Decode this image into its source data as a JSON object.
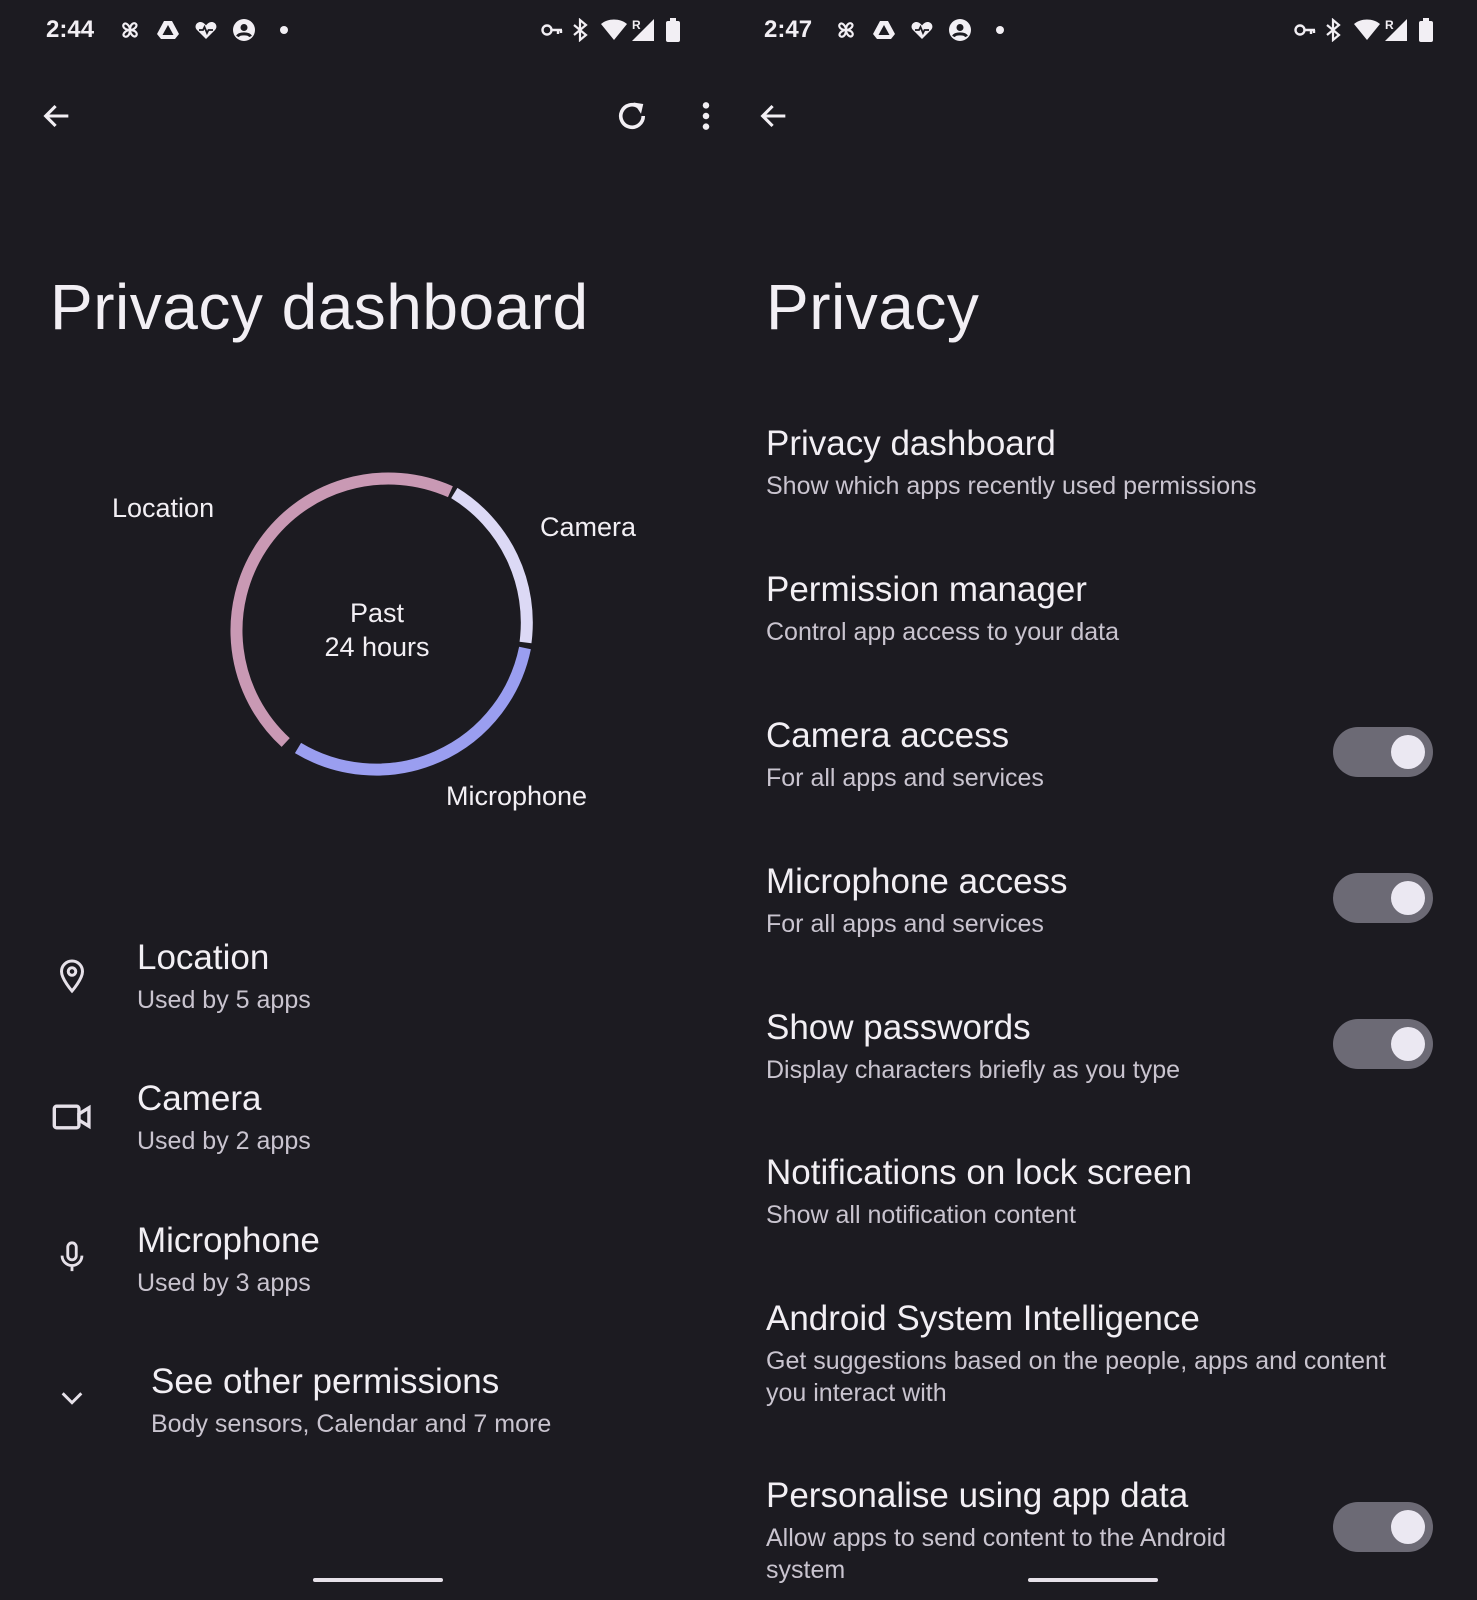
{
  "left": {
    "status_time": "2:44",
    "title": "Privacy dashboard",
    "chart": {
      "center_line1": "Past",
      "center_line2": "24 hours",
      "labels": {
        "location": "Location",
        "camera": "Camera",
        "microphone": "Microphone"
      },
      "colors": {
        "location": "#c999b4",
        "camera": "#dcd9f5",
        "microphone": "#9a9ef0"
      }
    },
    "permissions": [
      {
        "icon": "location-pin-icon",
        "title": "Location",
        "subtitle": "Used by 5 apps"
      },
      {
        "icon": "camera-icon",
        "title": "Camera",
        "subtitle": "Used by 2 apps"
      },
      {
        "icon": "microphone-icon",
        "title": "Microphone",
        "subtitle": "Used by 3 apps"
      }
    ],
    "other": {
      "icon": "chevron-down-icon",
      "title": "See other permissions",
      "subtitle": "Body sensors, Calendar and 7 more"
    }
  },
  "right": {
    "status_time": "2:47",
    "title": "Privacy",
    "settings": [
      {
        "title": "Privacy dashboard",
        "subtitle": "Show which apps recently used permissions"
      },
      {
        "title": "Permission manager",
        "subtitle": "Control app access to your data"
      },
      {
        "title": "Camera access",
        "subtitle": "For all apps and services",
        "toggle": "on"
      },
      {
        "title": "Microphone access",
        "subtitle": "For all apps and services",
        "toggle": "on"
      },
      {
        "title": "Show passwords",
        "subtitle": "Display characters briefly as you type",
        "toggle": "on"
      },
      {
        "title": "Notifications on lock screen",
        "subtitle": "Show all notification content"
      },
      {
        "title": "Android System Intelligence",
        "subtitle": "Get suggestions based on the people, apps and content you interact with"
      },
      {
        "title": "Personalise using app data",
        "subtitle": "Allow apps to send content to the Android system",
        "toggle": "on"
      }
    ]
  },
  "status_icons": [
    "pinwheel-icon",
    "drive-icon",
    "health-icon",
    "account-icon",
    "dot-icon",
    "vpn-key-icon",
    "bluetooth-icon",
    "wifi-icon",
    "signal-roaming-icon",
    "battery-icon"
  ],
  "status_roaming": "R"
}
